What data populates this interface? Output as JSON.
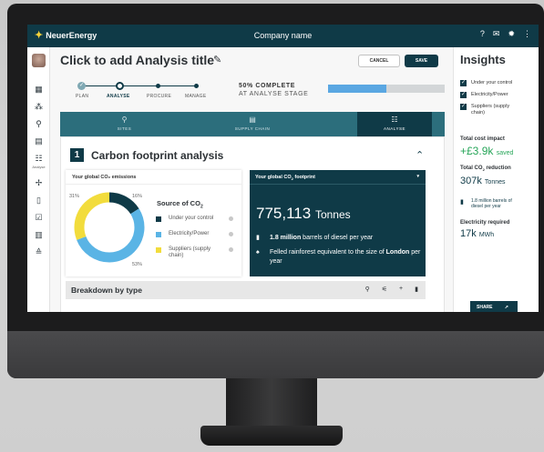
{
  "app": {
    "brand": "NeuerEnergy",
    "company": "Company name"
  },
  "topbar_icons": [
    "help-icon",
    "mail-icon",
    "settings-icon",
    "more-icon"
  ],
  "nav": {
    "items": [
      "dashboard-icon",
      "hierarchy-icon",
      "location-icon",
      "building-icon",
      "sliders-icon",
      "fan-icon",
      "document-icon",
      "checklist-icon",
      "table-icon",
      "layers-icon"
    ],
    "active_label": "Analyse"
  },
  "header": {
    "title": "Click to add Analysis title",
    "cancel_label": "CANCEL",
    "save_label": "SAVE"
  },
  "stepper": {
    "steps": [
      "PLAN",
      "ANALYSE",
      "PROCURE",
      "MANAGE"
    ],
    "current": "ANALYSE"
  },
  "progress": {
    "line1": "50% COMPLETE",
    "line2": "AT ANALYSE STAGE",
    "value": 0.5
  },
  "tabs": [
    {
      "label": "SITES",
      "icon": "location-icon"
    },
    {
      "label": "SUPPLY CHAIN",
      "icon": "building-icon"
    },
    {
      "label": "ANALYSE",
      "icon": "sliders-icon",
      "active": true
    }
  ],
  "section": {
    "number": "1",
    "title": "Carbon footprint analysis"
  },
  "emissions_card": {
    "heading": "Your global CO₂ emissions",
    "source_title": "Source of CO",
    "source_sub": "2",
    "legend": [
      {
        "label": "Under your control",
        "color": "#0f3a47"
      },
      {
        "label": "Electricity/Power",
        "color": "#5ab4e5"
      },
      {
        "label": "Suppliers (supply chain)",
        "color": "#f2dc3c"
      }
    ]
  },
  "chart_data": {
    "type": "pie",
    "categories": [
      "Under your control",
      "Electricity/Power",
      "Suppliers (supply chain)"
    ],
    "values": [
      16,
      53,
      31
    ],
    "value_labels": [
      "16%",
      "53%",
      "31%"
    ],
    "colors": [
      "#0f3a47",
      "#5ab4e5",
      "#f2dc3c"
    ],
    "donut": true
  },
  "footprint_card": {
    "heading_pre": "Your global CO",
    "heading_sub": "2",
    "heading_post": " footprint",
    "value": "775,113",
    "unit": "Tonnes",
    "fact1_bold": "1.8 million",
    "fact1_rest": " barrels of diesel per year",
    "fact2_pre": "Felled rainforest equivalent to the size of ",
    "fact2_bold": "London",
    "fact2_post": " per year"
  },
  "breakdown": {
    "title": "Breakdown by type",
    "icons": [
      "search-icon",
      "filter-icon",
      "add-icon",
      "delete-icon"
    ]
  },
  "insights": {
    "title": "Insights",
    "filters": [
      "Under your control",
      "Electricity/Power",
      "Suppliers (supply chain)"
    ],
    "cost_label": "Total cost impact",
    "cost_value": "+£3.9k",
    "cost_suffix": "saved",
    "co2_label_pre": "Total CO",
    "co2_label_sub": "2",
    "co2_label_post": " reduction",
    "co2_value": "307k",
    "co2_unit": "Tonnes",
    "barrels_note": "1.8 million barrels of diesel per year",
    "electricity_label": "Electricity required",
    "electricity_value": "17k",
    "electricity_unit": "MWh",
    "share_label": "SHARE"
  }
}
